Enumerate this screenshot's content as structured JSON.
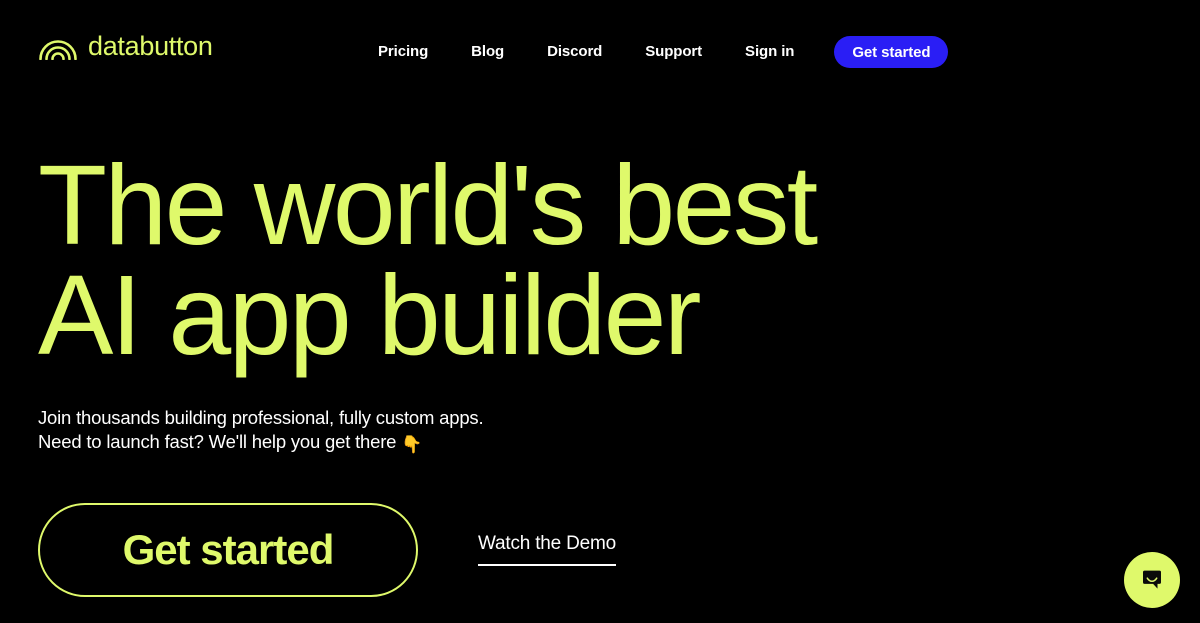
{
  "theme": {
    "background": "#000000",
    "accent": "#DFF96B",
    "cta_blue": "#2A1EF5",
    "text": "#FFFFFF"
  },
  "header": {
    "brand": {
      "name": "databutton",
      "icon": "rainbow-arcs-icon"
    },
    "nav": [
      {
        "label": "Pricing"
      },
      {
        "label": "Blog"
      },
      {
        "label": "Discord"
      },
      {
        "label": "Support"
      },
      {
        "label": "Sign in"
      }
    ],
    "cta": {
      "label": "Get started"
    }
  },
  "hero": {
    "headline_line1": "The world's best",
    "headline_line2": "AI app builder",
    "subhead_line1": "Join thousands building professional, fully custom apps.",
    "subhead_line2": "Need to launch fast? We'll help you get there",
    "subhead_emoji": "👇",
    "primary_cta": "Get started",
    "secondary_cta": "Watch the Demo"
  },
  "chat": {
    "icon": "chat-bubble-smile-icon"
  }
}
